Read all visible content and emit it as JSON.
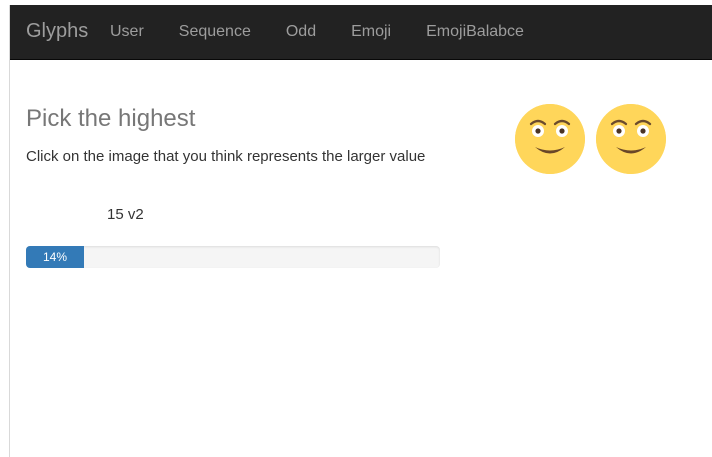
{
  "navbar": {
    "brand": "Glyphs",
    "items": [
      {
        "label": "User"
      },
      {
        "label": "Sequence"
      },
      {
        "label": "Odd"
      },
      {
        "label": "Emoji"
      },
      {
        "label": "EmojiBalabce"
      }
    ]
  },
  "main": {
    "title": "Pick the highest",
    "instruction": "Click on the image that you think represents the larger value",
    "trial_label": "15 v2",
    "progress": {
      "percent": 14,
      "label": "14%"
    },
    "options": [
      {
        "icon": "smiling-face-icon"
      },
      {
        "icon": "smiling-face-icon"
      }
    ]
  },
  "colors": {
    "navbar_background": "#222222",
    "navbar_text": "#9d9d9d",
    "progress_bar": "#337ab7",
    "emoji_face": "#ffd65a"
  }
}
